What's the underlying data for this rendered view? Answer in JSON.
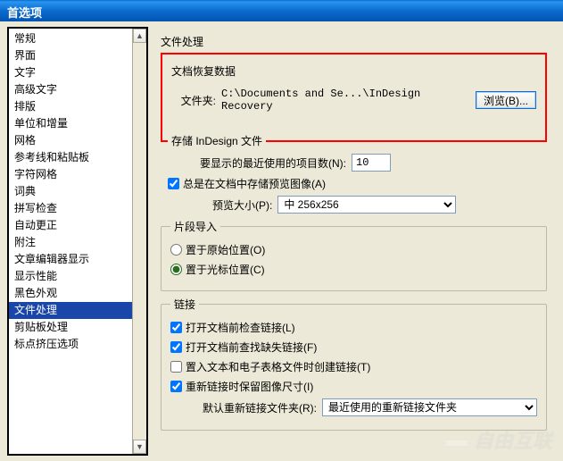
{
  "window": {
    "title": "首选项"
  },
  "sidebar": {
    "items": [
      {
        "label": "常规"
      },
      {
        "label": "界面"
      },
      {
        "label": "文字"
      },
      {
        "label": "高级文字"
      },
      {
        "label": "排版"
      },
      {
        "label": "单位和增量"
      },
      {
        "label": "网格"
      },
      {
        "label": "参考线和粘贴板"
      },
      {
        "label": "字符网格"
      },
      {
        "label": "词典"
      },
      {
        "label": "拼写检查"
      },
      {
        "label": "自动更正"
      },
      {
        "label": "附注"
      },
      {
        "label": "文章编辑器显示"
      },
      {
        "label": "显示性能"
      },
      {
        "label": "黑色外观"
      },
      {
        "label": "文件处理"
      },
      {
        "label": "剪贴板处理"
      },
      {
        "label": "标点挤压选项"
      }
    ],
    "selected_index": 16
  },
  "content": {
    "heading": "文件处理",
    "recovery": {
      "legend": "文档恢复数据",
      "folder_label": "文件夹:",
      "path": "C:\\Documents and Se...\\InDesign Recovery",
      "browse_label": "浏览(B)..."
    },
    "store": {
      "legend": "存储 InDesign 文件",
      "recent_label": "要显示的最近使用的项目数(N):",
      "recent_value": "10",
      "always_preview_label": "总是在文档中存储预览图像(A)",
      "always_preview_checked": true,
      "preview_size_label": "预览大小(P):",
      "preview_size_value": "中 256x256"
    },
    "snippet": {
      "legend": "片段导入",
      "radio1_label": "置于原始位置(O)",
      "radio2_label": "置于光标位置(C)",
      "selected": 2
    },
    "links": {
      "legend": "链接",
      "chk1_label": "打开文档前检查链接(L)",
      "chk1_checked": true,
      "chk2_label": "打开文档前查找缺失链接(F)",
      "chk2_checked": true,
      "chk3_label": "置入文本和电子表格文件时创建链接(T)",
      "chk3_checked": false,
      "chk4_label": "重新链接时保留图像尺寸(I)",
      "chk4_checked": true,
      "relink_label": "默认重新链接文件夹(R):",
      "relink_value": "最近使用的重新链接文件夹"
    }
  },
  "watermark": "自由互联"
}
